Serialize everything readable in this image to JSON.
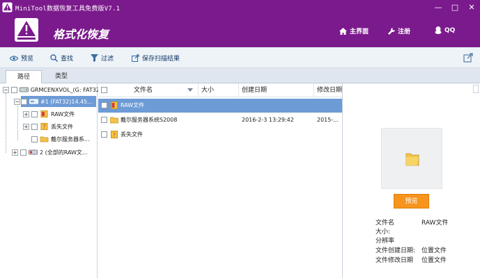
{
  "window": {
    "title": "MiniTool数据恢复工具免费版V7.1",
    "minimize": "—",
    "maximize": "□",
    "close": "✕"
  },
  "header": {
    "mode_title": "格式化恢复",
    "nav": {
      "home": "主界面",
      "register": "注册",
      "qq": "QQ"
    }
  },
  "toolbar": {
    "preview": "预览",
    "find": "查找",
    "filter": "过滤",
    "save_scan": "保存扫描结果"
  },
  "tabs": [
    "路径",
    "类型"
  ],
  "tree": {
    "drive": "GRMCENXVOL_(G: FAT32)",
    "partition": "#1 (FAT32)14.45...",
    "children": [
      "RAW文件",
      "丢失文件",
      "戴尔服务器系..."
    ],
    "other": "2 (全部的RAW文..."
  },
  "list": {
    "columns": [
      "文件名",
      "大小",
      "创建日期",
      "修改日期"
    ],
    "rows": [
      {
        "name": "RAW文件",
        "size": "",
        "created": "",
        "modified": ""
      },
      {
        "name": "戴尔服务器系统S2008",
        "size": "",
        "created": "2016-2-3 13:29:42",
        "modified": "2015-..."
      },
      {
        "name": "丢失文件",
        "size": "",
        "created": "",
        "modified": ""
      }
    ]
  },
  "preview": {
    "button": "预览",
    "fields": [
      {
        "label": "文件名",
        "value": "RAW文件"
      },
      {
        "label": "大小:",
        "value": ""
      },
      {
        "label": "分辨率",
        "value": ""
      },
      {
        "label": "文件创建日期:",
        "value": "位置文件"
      },
      {
        "label": "文件修改日期",
        "value": "位置文件"
      }
    ]
  },
  "colors": {
    "brand_purple": "#7b1a8c",
    "selection_blue": "#6d9bd6",
    "preview_orange": "#f7941d"
  }
}
